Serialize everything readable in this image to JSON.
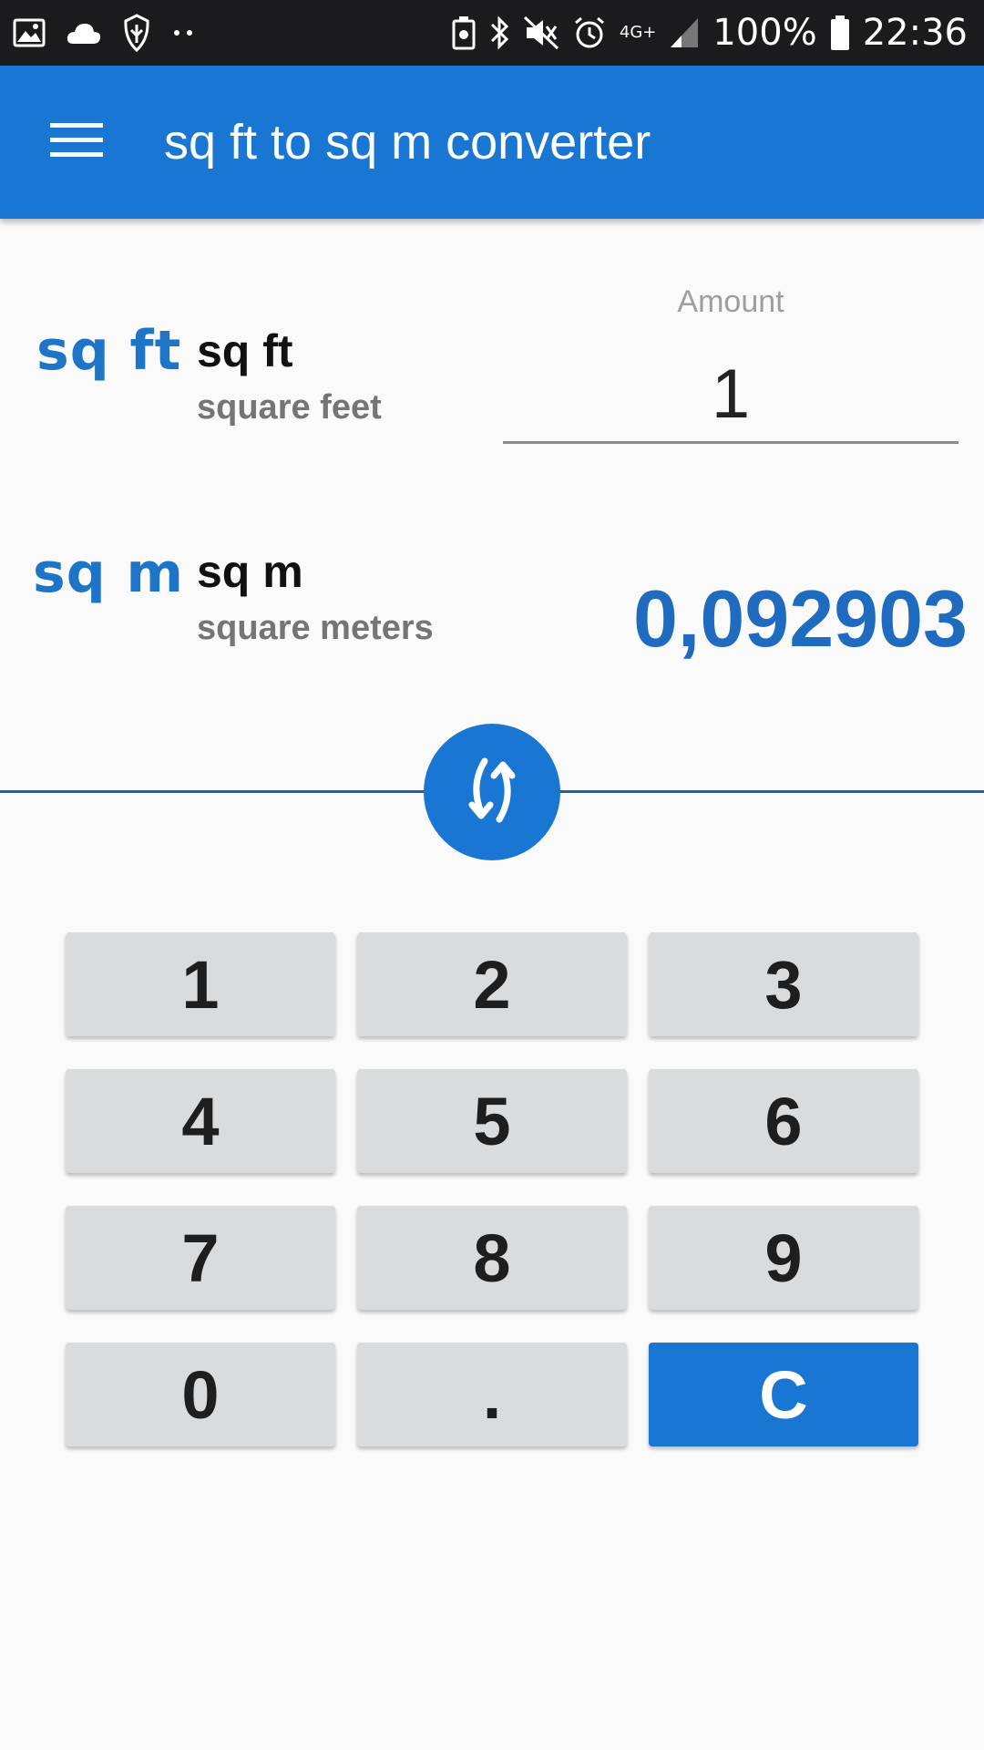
{
  "status_bar": {
    "battery": "100%",
    "time": "22:36",
    "network": "4G+"
  },
  "app_bar": {
    "title": "sq ft to sq m converter"
  },
  "from_unit": {
    "logo": "sq ft",
    "symbol": "sq ft",
    "name": "square feet"
  },
  "amount": {
    "label": "Amount",
    "value": "1"
  },
  "to_unit": {
    "logo": "sq m",
    "symbol": "sq m",
    "name": "square meters"
  },
  "result": {
    "value": "0,092903"
  },
  "keypad": {
    "k1": "1",
    "k2": "2",
    "k3": "3",
    "k4": "4",
    "k5": "5",
    "k6": "6",
    "k7": "7",
    "k8": "8",
    "k9": "9",
    "k0": "0",
    "dot": ".",
    "clear": "C"
  },
  "colors": {
    "primary": "#1976d2",
    "key_background": "#dadbdd",
    "status_bar": "#1b1b1d"
  },
  "icons": {
    "menu": "hamburger-menu-icon",
    "swap": "swap-arrows-icon"
  }
}
